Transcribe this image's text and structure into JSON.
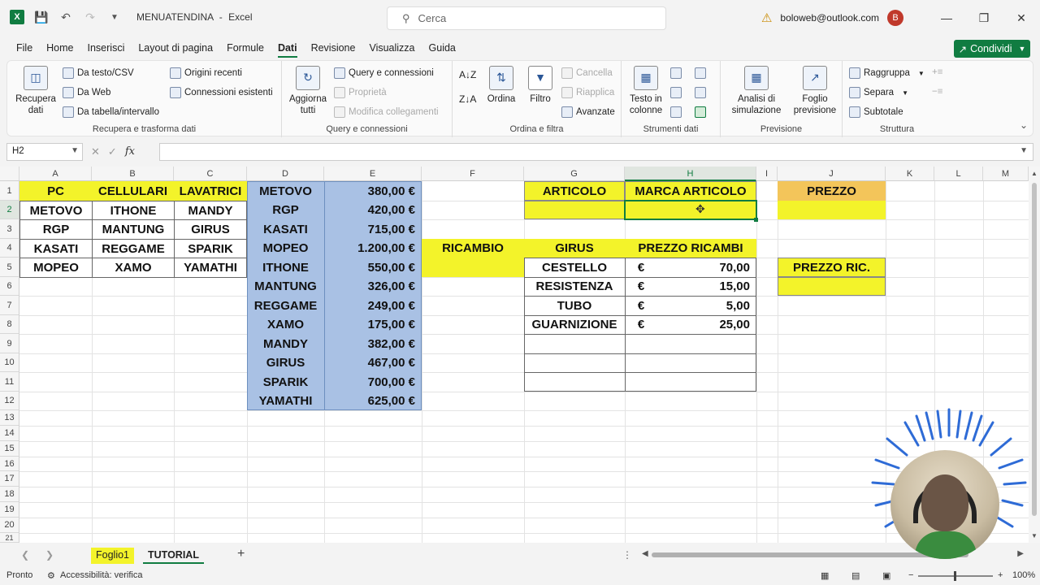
{
  "titlebar": {
    "doc_name": "MENUATENDINA",
    "separator": "-",
    "app_name": "Excel",
    "search_placeholder": "Cerca",
    "account": "boloweb@outlook.com",
    "avatar_letter": "B"
  },
  "menu": {
    "tabs": [
      "File",
      "Home",
      "Inserisci",
      "Layout di pagina",
      "Formule",
      "Dati",
      "Revisione",
      "Visualizza",
      "Guida"
    ],
    "active_tab": "Dati",
    "share_label": "Condividi"
  },
  "ribbon": {
    "get_data": {
      "big": "Recupera dati",
      "items": [
        "Da testo/CSV",
        "Da Web",
        "Da tabella/intervallo"
      ],
      "items2": [
        "Origini recenti",
        "Connessioni esistenti"
      ],
      "label": "Recupera e trasforma dati"
    },
    "queries": {
      "big": "Aggiorna tutti",
      "items": [
        "Query e connessioni",
        "Proprietà",
        "Modifica collegamenti"
      ],
      "label": "Query e connessioni"
    },
    "sort": {
      "sort_label": "Ordina",
      "filter_label": "Filtro",
      "items": [
        "Cancella",
        "Riapplica",
        "Avanzate"
      ],
      "label": "Ordina e filtra"
    },
    "tools": {
      "big": "Testo in colonne",
      "label": "Strumenti dati"
    },
    "forecast": {
      "whatif": "Analisi di simulazione",
      "sheet": "Foglio previsione",
      "label": "Previsione"
    },
    "outline": {
      "items": [
        "Raggruppa",
        "Separa",
        "Subtotale"
      ],
      "label": "Struttura"
    }
  },
  "formula": {
    "name_box": "H2",
    "content": ""
  },
  "grid": {
    "columns": [
      "A",
      "B",
      "C",
      "D",
      "E",
      "F",
      "G",
      "H",
      "I",
      "J",
      "K",
      "L",
      "M"
    ],
    "selected_column": "H",
    "rows": [
      "1",
      "2",
      "3",
      "4",
      "5",
      "6",
      "7",
      "8",
      "9",
      "10",
      "11",
      "12",
      "13",
      "14",
      "15",
      "16",
      "17",
      "18",
      "19",
      "20",
      "21"
    ],
    "selected_row": "2",
    "headers_abc": [
      "PC",
      "CELLULARI",
      "LAVATRICI"
    ],
    "table_abc": [
      [
        "METOVO",
        "ITHONE",
        "MANDY"
      ],
      [
        "RGP",
        "MANTUNG",
        "GIRUS"
      ],
      [
        "KASATI",
        "REGGAME",
        "SPARIK"
      ],
      [
        "MOPEO",
        "XAMO",
        "YAMATHI"
      ]
    ],
    "prices": [
      [
        "METOVO",
        "380,00 €"
      ],
      [
        "RGP",
        "420,00 €"
      ],
      [
        "KASATI",
        "715,00 €"
      ],
      [
        "MOPEO",
        "1.200,00 €"
      ],
      [
        "ITHONE",
        "550,00 €"
      ],
      [
        "MANTUNG",
        "326,00 €"
      ],
      [
        "REGGAME",
        "249,00 €"
      ],
      [
        "XAMO",
        "175,00 €"
      ],
      [
        "MANDY",
        "382,00 €"
      ],
      [
        "GIRUS",
        "467,00 €"
      ],
      [
        "SPARIK",
        "700,00 €"
      ],
      [
        "YAMATHI",
        "625,00 €"
      ]
    ],
    "articolo": "ARTICOLO",
    "marca_articolo": "MARCA ARTICOLO",
    "prezzo": "PREZZO",
    "ricambio": "RICAMBIO",
    "girus": "GIRUS",
    "prezzo_ricambi": "PREZZO RICAMBI",
    "prezzo_ric": "PREZZO RIC.",
    "parts": [
      [
        "CESTELLO",
        "€",
        "70,00"
      ],
      [
        "RESISTENZA",
        "€",
        "15,00"
      ],
      [
        "TUBO",
        "€",
        "5,00"
      ],
      [
        "GUARNIZIONE",
        "€",
        "25,00"
      ]
    ]
  },
  "sheets": {
    "tabs": [
      "Foglio1",
      "TUTORIAL"
    ],
    "active": "TUTORIAL",
    "add": "+"
  },
  "status": {
    "ready": "Pronto",
    "accessibility": "Accessibilità: verifica",
    "zoom": "100%"
  },
  "colors": {
    "accent": "#107c41",
    "yellow": "#f3f32a",
    "orange": "#f3c55a",
    "blue": "#a9c1e4"
  }
}
